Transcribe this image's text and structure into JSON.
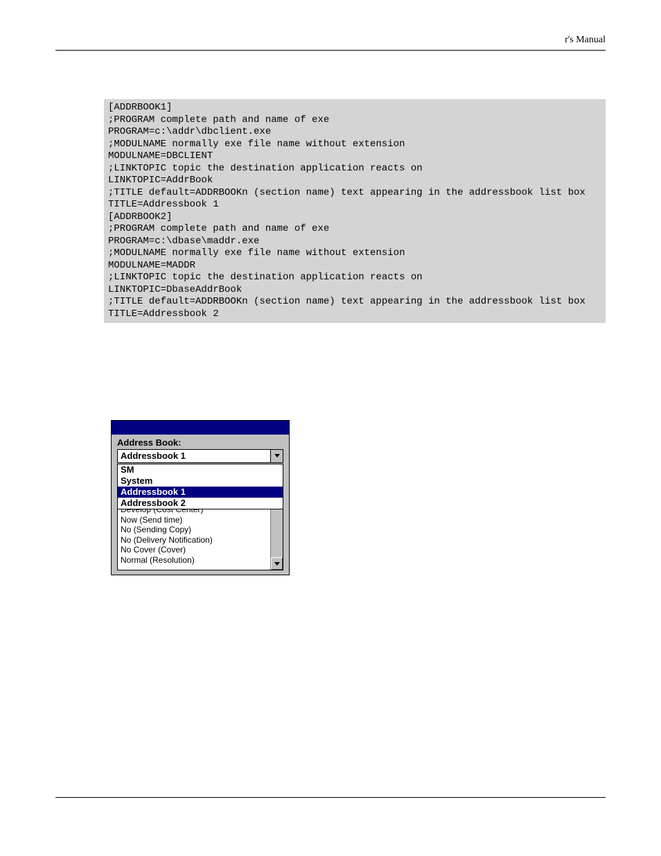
{
  "header": {
    "title_fragment": "r's Manual"
  },
  "code": {
    "lines": [
      "[ADDRBOOK1]",
      ";PROGRAM complete path and name of exe",
      "PROGRAM=c:\\addr\\dbclient.exe",
      ";MODULNAME normally exe file name without extension",
      "MODULNAME=DBCLIENT",
      ";LINKTOPIC topic the destination application reacts on",
      "LINKTOPIC=AddrBook",
      ";TITLE default=ADDRBOOKn (section name) text appearing in the addressbook list box",
      "TITLE=Addressbook 1",
      "[ADDRBOOK2]",
      ";PROGRAM complete path and name of exe",
      "PROGRAM=c:\\dbase\\maddr.exe",
      ";MODULNAME normally exe file name without extension",
      "MODULNAME=MADDR",
      ";LINKTOPIC topic the destination application reacts on",
      "LINKTOPIC=DbaseAddrBook",
      ";TITLE default=ADDRBOOKn (section name) text appearing in the addressbook list box",
      "TITLE=Addressbook 2"
    ]
  },
  "dialog": {
    "label": "Address Book:",
    "combo_value": "Addressbook 1",
    "dropdown": [
      {
        "text": "SM",
        "selected": false
      },
      {
        "text": "System",
        "selected": false
      },
      {
        "text": "Addressbook 1",
        "selected": true
      },
      {
        "text": "Addressbook 2",
        "selected": false
      }
    ],
    "listbox": [
      "Develop  (Cost Center)",
      "Now  (Send time)",
      "No  (Sending Copy)",
      "No  (Delivery Notification)",
      "No Cover  (Cover)",
      "Normal  (Resolution)"
    ]
  }
}
